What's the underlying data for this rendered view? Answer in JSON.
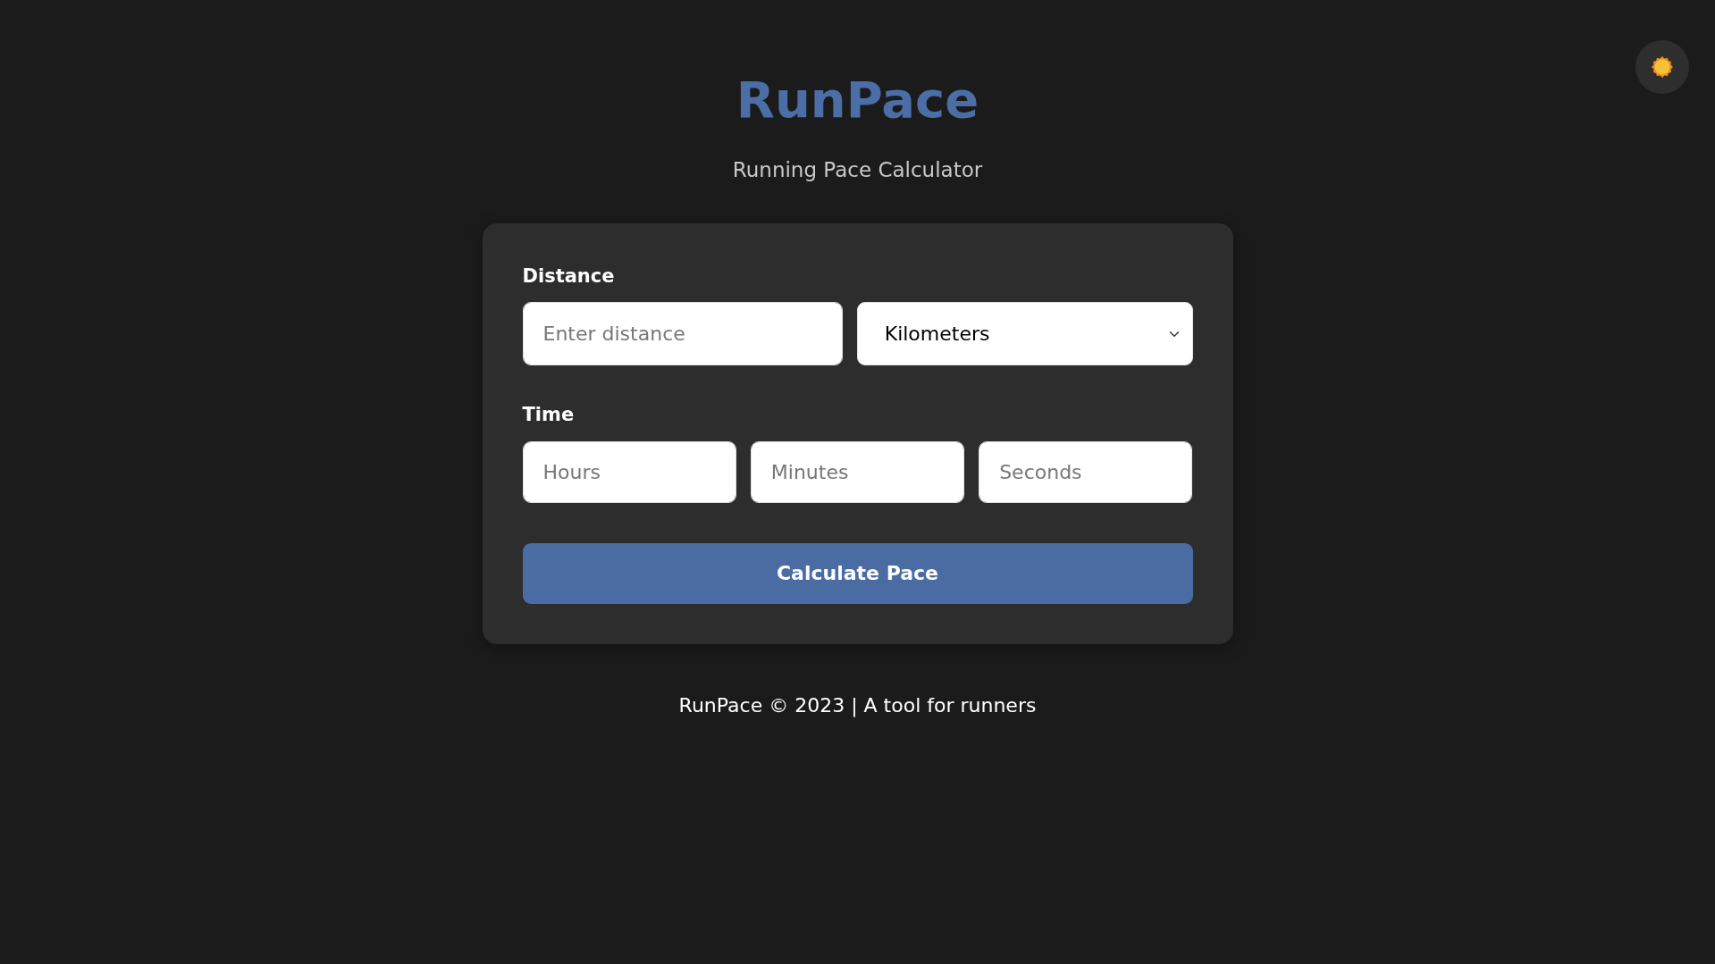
{
  "header": {
    "title": "RunPace",
    "subtitle": "Running Pace Calculator"
  },
  "form": {
    "distance": {
      "label": "Distance",
      "placeholder": "Enter distance",
      "unit": "Kilometers"
    },
    "time": {
      "label": "Time",
      "fields": [
        {
          "placeholder": "Hours"
        },
        {
          "placeholder": "Minutes"
        },
        {
          "placeholder": "Seconds"
        }
      ]
    },
    "submit": "Calculate Pace"
  },
  "footer": "RunPace © 2023 | A tool for runners"
}
